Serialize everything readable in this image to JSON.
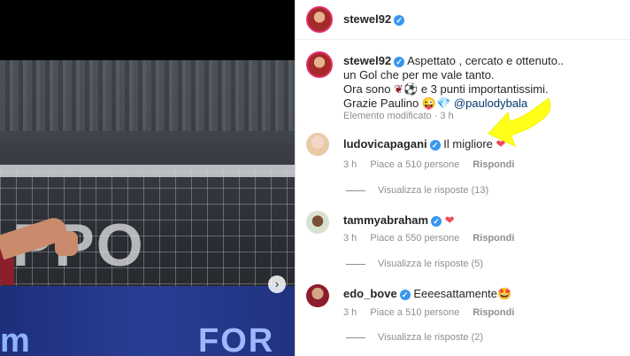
{
  "post": {
    "author": "stewel92",
    "caption": {
      "line1": "Aspettato , cercato e ottenuto..",
      "line2": "un Gol che per me vale tanto.",
      "line3_a": "Ora sono",
      "line3_b": "e 3 punti importantissimi.",
      "line4_a": "Grazie Paulino",
      "mention": "@paulodybala"
    },
    "edited_meta": "Elemento modificato · 3 h",
    "image": {
      "banner_text": "PPO",
      "board_left": "m",
      "board_right": "FOR"
    }
  },
  "comments": [
    {
      "user": "ludovicapagani",
      "text": "Il migliore",
      "emoji": "❤",
      "time": "3 h",
      "likes": "Piace a 510 persone",
      "reply": "Rispondi",
      "view_replies": "Visualizza le risposte (13)"
    },
    {
      "user": "tammyabraham",
      "text": "",
      "emoji": "❤",
      "time": "3 h",
      "likes": "Piace a 550 persone",
      "reply": "Rispondi",
      "view_replies": "Visualizza le risposte (5)"
    },
    {
      "user": "edo_bove",
      "text": "Eeeesattamente",
      "emoji": "🤩",
      "time": "3 h",
      "likes": "Piace a 510 persone",
      "reply": "Rispondi",
      "view_replies": "Visualizza le risposte (2)"
    }
  ],
  "icons": {
    "verified": "verified-badge-icon",
    "next": "chevron-right-icon",
    "annotation": "yellow-arrow-annotation"
  },
  "colors": {
    "verified_blue": "#3897f0",
    "heart_red": "#ed4956",
    "annotation_yellow": "#ffff1a"
  }
}
